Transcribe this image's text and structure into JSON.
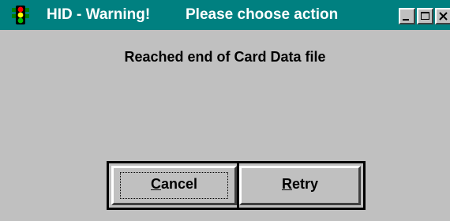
{
  "window": {
    "app_title": "HID - Warning!",
    "message_title": "Please choose action"
  },
  "titlebar": {
    "icon": "traffic-light-icon",
    "minimize_icon": "minimize-icon",
    "maximize_icon": "maximize-icon",
    "close_icon": "close-icon"
  },
  "dialog": {
    "message": "Reached end of Card Data file",
    "buttons": {
      "cancel": {
        "mnemonic": "C",
        "rest": "ancel"
      },
      "retry": {
        "mnemonic": "R",
        "rest": "etry"
      }
    }
  },
  "colors": {
    "titlebar": "#008080",
    "window_face": "#c0c0c0",
    "title_text": "#ffffff"
  }
}
